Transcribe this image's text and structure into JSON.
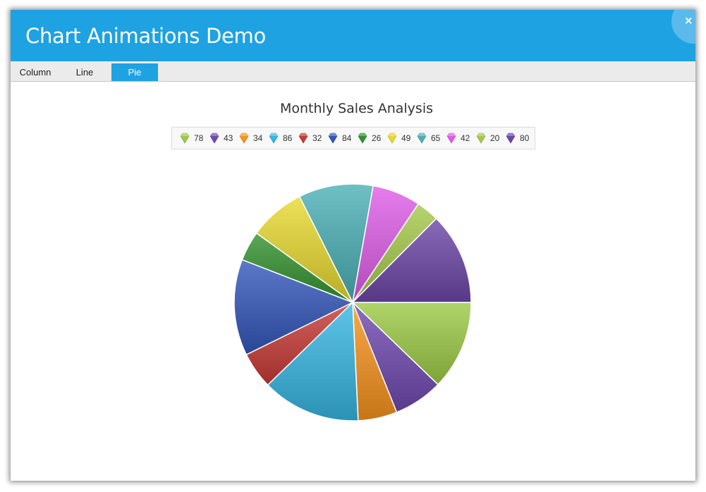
{
  "window": {
    "title": "Chart Animations Demo",
    "close_label": "×",
    "accent_color": "#1ea2e2"
  },
  "tabs": [
    {
      "label": "Column",
      "active": false
    },
    {
      "label": "Line",
      "active": false
    },
    {
      "label": "Pie",
      "active": true
    }
  ],
  "chart_data": {
    "type": "pie",
    "title": "Monthly Sales Analysis",
    "values": [
      78,
      43,
      34,
      86,
      32,
      84,
      26,
      49,
      65,
      42,
      20,
      80
    ],
    "colors": [
      "#9ccb45",
      "#7148b0",
      "#f7941d",
      "#36b7e4",
      "#c83a34",
      "#3356bb",
      "#33922e",
      "#e7d92e",
      "#4ab0b5",
      "#de5ce9",
      "#a5c94b",
      "#6b46a8"
    ],
    "legend": {
      "labels": [
        "78",
        "43",
        "34",
        "86",
        "32",
        "84",
        "26",
        "49",
        "65",
        "42",
        "20",
        "80"
      ],
      "placement": "top",
      "marker": "diamond"
    },
    "start_angle": "3 o'clock",
    "direction": "clockwise"
  }
}
